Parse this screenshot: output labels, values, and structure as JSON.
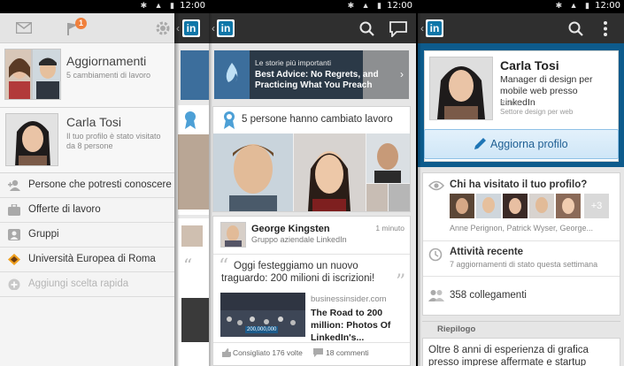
{
  "status": {
    "time": "12:00"
  },
  "panel1": {
    "updates_title": "Aggiornamenti",
    "updates_sub": "5 cambiamenti di lavoro",
    "badge_count": "1",
    "profile_name": "Carla Tosi",
    "profile_sub": "Il tuo profilo è stato visitato da 8 persone",
    "menu": [
      {
        "label": "Persone che potresti conoscere"
      },
      {
        "label": "Offerte di lavoro"
      },
      {
        "label": "Gruppi"
      },
      {
        "label": "Università Europea di Roma"
      },
      {
        "label": "Aggiungi scelta rapida"
      }
    ]
  },
  "panel2": {
    "logo": "in",
    "banner_kicker": "Le storie più importanti",
    "banner_title": "Best Advice: No Regrets, and Practicing What You Preach",
    "changed_text": "5 persone hanno cambiato lavoro",
    "post_author": "George Kingsten",
    "post_group": "Gruppo aziendale LinkedIn",
    "post_time": "1 minuto",
    "post_text": "Oggi festeggiamo un nuovo traguardo: 200 milioni di iscrizioni!",
    "link_domain": "businessinsider.com",
    "link_title": "The Road to 200 million: Photos Of LinkedIn's...",
    "thumb_badge": "200,000,000",
    "recommended": "Consigliato 176 volte",
    "comments": "18 commenti"
  },
  "panel3": {
    "logo": "in",
    "name": "Carla Tosi",
    "headline": "Manager di design per mobile web presso LinkedIn",
    "location": "Roma",
    "industry": "Settore design per web",
    "update_button": "Aggiorna profilo",
    "visitors_title": "Chi ha visitato il tuo profilo?",
    "visitors_more": "+3",
    "visitors_names": "Anne Perignon, Patrick Wyser, George...",
    "activity_title": "Attività recente",
    "activity_sub": "7 aggiornamenti di stato questa settimana",
    "connections": "358 collegamenti",
    "summary_label": "Riepilogo",
    "summary_text": "Oltre 8 anni di esperienza di grafica presso imprese affermate e startup"
  },
  "colors": {
    "linkedin_blue": "#0e76a8",
    "badge_orange": "#f0803c",
    "dark_bar": "#2f2f2f",
    "profile_blue": "#0d5b8c"
  }
}
